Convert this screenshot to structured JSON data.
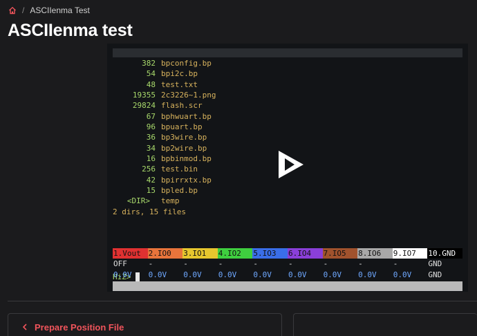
{
  "breadcrumb": {
    "current": "ASCIIenma Test",
    "separator": "/"
  },
  "page_title": "ASCIIenma test",
  "terminal": {
    "files": [
      {
        "size": "382",
        "name": "bpconfig.bp"
      },
      {
        "size": "54",
        "name": "bpi2c.bp"
      },
      {
        "size": "48",
        "name": "test.txt"
      },
      {
        "size": "19355",
        "name": "2c3226~1.png"
      },
      {
        "size": "29824",
        "name": "flash.scr"
      },
      {
        "size": "67",
        "name": "bphwuart.bp"
      },
      {
        "size": "96",
        "name": "bpuart.bp"
      },
      {
        "size": "36",
        "name": "bp3wire.bp"
      },
      {
        "size": "34",
        "name": "bp2wire.bp"
      },
      {
        "size": "16",
        "name": "bpbinmod.bp"
      },
      {
        "size": "256",
        "name": "test.bin"
      },
      {
        "size": "42",
        "name": "bpirrxtx.bp"
      },
      {
        "size": "15",
        "name": "bpled.bp"
      }
    ],
    "dir_entry": {
      "tag": "<DIR>",
      "name": "temp"
    },
    "summary": "2 dirs, 15 files",
    "prompt": "HiZ>",
    "pins": [
      {
        "label": "1.Vout",
        "color": "#e03131"
      },
      {
        "label": "2.IO0",
        "color": "#e8743b"
      },
      {
        "label": "3.IO1",
        "color": "#e6c62e"
      },
      {
        "label": "4.IO2",
        "color": "#3fcf3f"
      },
      {
        "label": "5.IO3",
        "color": "#3a6ee8"
      },
      {
        "label": "6.IO4",
        "color": "#8a3fd9"
      },
      {
        "label": "7.IO5",
        "color": "#a0522d"
      },
      {
        "label": "8.IO6",
        "color": "#a8a8a8"
      },
      {
        "label": "9.IO7",
        "color": "#ffffff"
      },
      {
        "label": "10.GND",
        "color": "#000000"
      }
    ],
    "states": [
      "OFF",
      "-",
      "-",
      "-",
      "-",
      "-",
      "-",
      "-",
      "-",
      "GND"
    ],
    "voltages": [
      "0.0V",
      "0.0V",
      "0.0V",
      "0.0V",
      "0.0V",
      "0.0V",
      "0.0V",
      "0.0V",
      "0.0V",
      "GND"
    ]
  },
  "nav": {
    "prev_label": "Prepare Position File"
  },
  "colors": {
    "accent": "#f0545b",
    "background": "#1b1b1d"
  }
}
